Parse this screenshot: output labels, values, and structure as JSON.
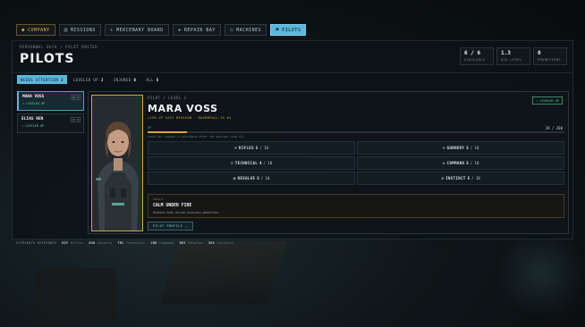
{
  "tabs": [
    {
      "icon": "◆",
      "label": "COMPANY",
      "key": "company"
    },
    {
      "icon": "▤",
      "label": "MISSIONS",
      "key": "missions"
    },
    {
      "icon": "✦",
      "label": "MERCENARY BOARD",
      "key": "mercenary"
    },
    {
      "icon": "✚",
      "label": "REPAIR BAY",
      "key": "repair"
    },
    {
      "icon": "⌂",
      "label": "MACHINES",
      "key": "machines"
    },
    {
      "icon": "⚑",
      "label": "PILOTS",
      "key": "pilots"
    }
  ],
  "header": {
    "breadcrumb": "PERSONNEL DECK / PILOT ROSTER",
    "title": "PILOTS",
    "stats": [
      {
        "value": "6 / 6",
        "label": "AVAILABLE"
      },
      {
        "value": "1.3",
        "label": "AVG LEVEL"
      },
      {
        "value": "0",
        "label": "PROMOTIONS"
      }
    ]
  },
  "filters": [
    {
      "label": "NEEDS ATTENTION",
      "count": "2"
    },
    {
      "label": "LEVELED UP",
      "count": "2"
    },
    {
      "label": "INJURED",
      "count": "0"
    },
    {
      "label": "ALL",
      "count": "6"
    }
  ],
  "roster": [
    {
      "name": "MARA VOSS",
      "status": "↑ LEVELED UP",
      "level": "LV 2",
      "selected": true
    },
    {
      "name": "ELIAS REN",
      "status": "↑ LEVELED UP",
      "level": "LV 2",
      "selected": false
    }
  ],
  "detail": {
    "crumb": "PILOT / LEVEL 2",
    "name": "MARA VOSS",
    "subtitle": "+150 XP LAST MISSION · RAVENFALL-IS 01",
    "badge": "↗ LEVELED UP",
    "xp_label": "XP",
    "xp_value": "19 / 200",
    "xp_fraction": 0.095,
    "xp_hint": "Level-up: choose +1 attribute after the mission (cap 10).",
    "attributes": [
      {
        "icon": "✜",
        "name": "RIFLES",
        "value": "5",
        "max": "/ 10"
      },
      {
        "icon": "✜",
        "name": "GUNNERY",
        "value": "5",
        "max": "/ 10"
      },
      {
        "icon": "⚙",
        "name": "TECHNICAL",
        "value": "4",
        "max": "/ 10"
      },
      {
        "icon": "◈",
        "name": "COMMAND",
        "value": "5",
        "max": "/ 10"
      },
      {
        "icon": "◉",
        "name": "RESOLVE",
        "value": "5",
        "max": "/ 10"
      },
      {
        "icon": "✺",
        "name": "INSTINCT",
        "value": "5",
        "max": "/ 10"
      }
    ],
    "trait": {
      "key": "TRAIT",
      "title": "CALM UNDER FIRE",
      "desc": "Reduces heat-driven accuracy penalties."
    },
    "profile_button": "PILOT PROFILE",
    "profile_chevron": "⌄"
  },
  "legend": {
    "title": "ATTRIBUTE REFERENCE",
    "items": [
      {
        "abbr": "RIF",
        "name": "Rifles"
      },
      {
        "abbr": "GUN",
        "name": "Gunnery"
      },
      {
        "abbr": "TEC",
        "name": "Technical"
      },
      {
        "abbr": "CMD",
        "name": "Command"
      },
      {
        "abbr": "RES",
        "name": "Resolve"
      },
      {
        "abbr": "INS",
        "name": "Instinct"
      }
    ]
  },
  "colors": {
    "accent": "#5ab6dc",
    "gold": "#d6a43a",
    "leveled": "#5ed39a"
  }
}
